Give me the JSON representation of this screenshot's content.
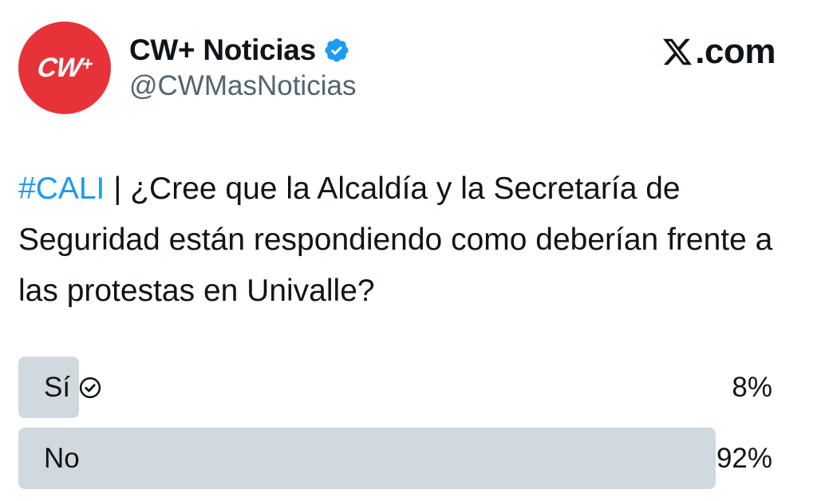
{
  "account": {
    "avatar_text": "CW",
    "avatar_plus": "+",
    "avatar_color": "#e8323a",
    "display_name": "CW+ Noticias",
    "handle": "@CWMasNoticias",
    "verified": true,
    "verified_color": "#1d9bf0"
  },
  "source": {
    "logo_icon": "x-logo-icon",
    "text": ".com"
  },
  "tweet": {
    "hashtag": "#CALI",
    "separator": " | ",
    "text": "¿Cree que la Alcaldía y la Secretaría de Seguridad están respondiendo como deberían frente a las protestas en Univalle?",
    "hashtag_color": "#1d9bf0"
  },
  "poll": {
    "bar_color": "#cfd9de",
    "options": [
      {
        "label": "Sí",
        "percent_text": "8%",
        "fraction": 0.08,
        "selected": true
      },
      {
        "label": "No",
        "percent_text": "92%",
        "fraction": 0.92,
        "selected": false
      }
    ]
  }
}
